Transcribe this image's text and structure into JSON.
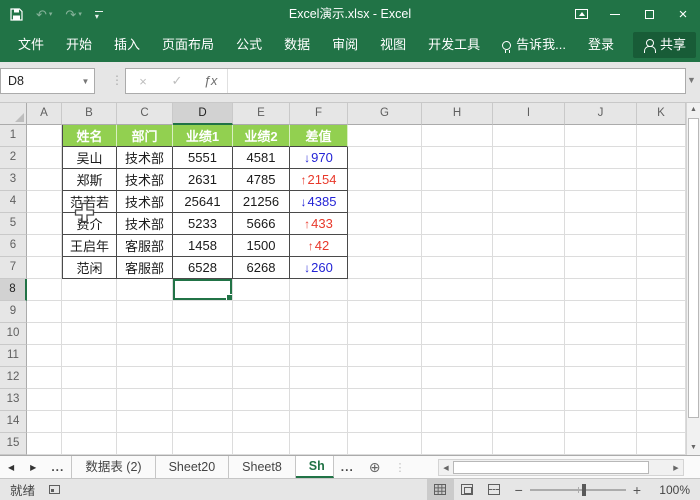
{
  "titlebar": {
    "title": "Excel演示.xlsx - Excel"
  },
  "ribbon": {
    "tabs": [
      {
        "label": "文件"
      },
      {
        "label": "开始"
      },
      {
        "label": "插入"
      },
      {
        "label": "页面布局"
      },
      {
        "label": "公式"
      },
      {
        "label": "数据"
      },
      {
        "label": "审阅"
      },
      {
        "label": "视图"
      },
      {
        "label": "开发工具"
      },
      {
        "label": "告诉我...",
        "icon": "lightbulb-icon"
      },
      {
        "label": "登录"
      },
      {
        "label": "共享",
        "icon": "person-add-icon",
        "variant": "share"
      }
    ]
  },
  "formula_bar": {
    "name_box": "D8",
    "formula_value": ""
  },
  "sheet": {
    "selected_cell": "D8",
    "selected_column": "D",
    "selected_row": 8,
    "columns": [
      "A",
      "B",
      "C",
      "D",
      "E",
      "F",
      "G",
      "H",
      "I",
      "J",
      "K"
    ],
    "row_numbers": [
      1,
      2,
      3,
      4,
      5,
      6,
      7,
      8,
      9,
      10,
      11,
      12,
      13,
      14,
      15
    ],
    "table": {
      "start_column": "B",
      "header_bg": "#92D050",
      "up_color": "#E8392B",
      "down_color": "#2424D6",
      "headers": [
        "姓名",
        "部门",
        "业绩1",
        "业绩2",
        "差值"
      ],
      "rows": [
        {
          "cells": [
            "吴山",
            "技术部",
            "5551",
            "4581"
          ],
          "diff": {
            "dir": "down",
            "value": "970"
          }
        },
        {
          "cells": [
            "郑斯",
            "技术部",
            "2631",
            "4785"
          ],
          "diff": {
            "dir": "up",
            "value": "2154"
          }
        },
        {
          "cells": [
            "范若若",
            "技术部",
            "25641",
            "21256"
          ],
          "diff": {
            "dir": "down",
            "value": "4385"
          }
        },
        {
          "cells": [
            "费介",
            "技术部",
            "5233",
            "5666"
          ],
          "diff": {
            "dir": "up",
            "value": "433"
          }
        },
        {
          "cells": [
            "王启年",
            "客服部",
            "1458",
            "1500"
          ],
          "diff": {
            "dir": "up",
            "value": "42"
          }
        },
        {
          "cells": [
            "范闲",
            "客服部",
            "6528",
            "6268"
          ],
          "diff": {
            "dir": "down",
            "value": "260"
          }
        }
      ]
    }
  },
  "sheet_tabs": {
    "tabs": [
      {
        "label": "数据表 (2)"
      },
      {
        "label": "Sheet20"
      },
      {
        "label": "Sheet8"
      },
      {
        "label": "Sh",
        "active": true
      }
    ],
    "overflow_left": "...",
    "overflow_right": "..."
  },
  "status_bar": {
    "mode": "就绪",
    "zoom_level": "100%"
  },
  "colors": {
    "accent_green": "#217346",
    "share_button_green": "#185C37"
  }
}
